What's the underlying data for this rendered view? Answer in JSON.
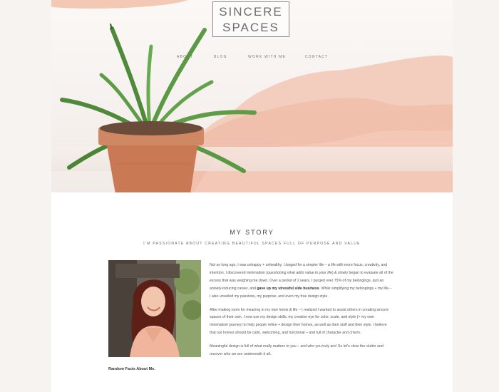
{
  "header": {
    "logo_line1": "SINCERE",
    "logo_line2": "SPACES"
  },
  "nav": {
    "items": [
      "ABOUT",
      "BLOG",
      "WORK WITH ME",
      "CONTACT"
    ]
  },
  "story": {
    "title": "MY STORY",
    "subtitle": "I'M PASSIONATE ABOUT CREATING BEAUTIFUL SPACES FULL OF PURPOSE AND VALUE",
    "p1_a": "Not so long ago, I was unhappy + unhealthy. I ",
    "p1_b": "longed",
    "p1_c": " for a simpler life – a life with more focus, creativity, and intention. I discovered minimalism (",
    "p1_d": "questioning what adds value to your life",
    "p1_e": ") & slowly began to evaluate all of the excess that was weighing me down. Over a period of 2 years, I purged over 75% of my belongings, quit an anxiety-inducing career, and ",
    "p1_f": "gave up my stressful side business",
    "p1_g": ". While simplifying my belongings + my life – I also unveiled my passions, my purpose, and even my true design style.",
    "p2": "After making room for meaning in my own home & life – I realized I wanted to assist others in creating sincere spaces of their own. I now use my design skills, my creative eye for color, scale, and style (+ my own minimalism journey) to help people refine + design their homes, as well as their stuff and their style. I believe that our homes should be calm, welcoming, and functional – and full of character and charm.",
    "p3": "Meaningful design is full of what really matters to you – and who you truly are! So let's clear the clutter and uncover who we are underneath it all..",
    "random_facts": "Random Facts About Me."
  },
  "colors": {
    "accent_wash": "#f1bfa8",
    "page_bg": "#f7f3f0"
  }
}
